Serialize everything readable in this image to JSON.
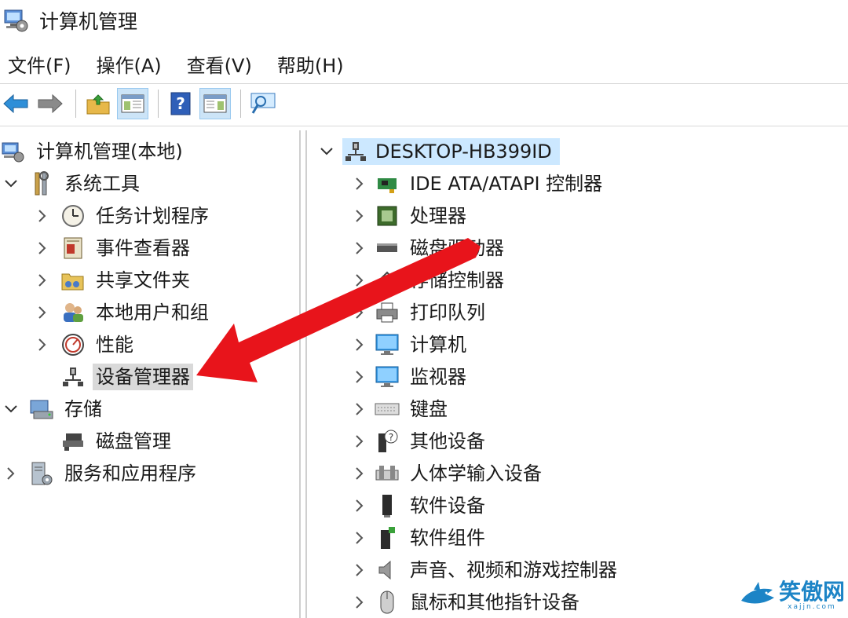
{
  "window": {
    "title": "计算机管理",
    "icon": "computer-management-icon"
  },
  "menu": [
    "文件(F)",
    "操作(A)",
    "查看(V)",
    "帮助(H)"
  ],
  "toolbar": {
    "buttons": [
      "back-arrow-icon",
      "forward-arrow-icon",
      "up-folder-icon",
      "show-hide-console-tree-icon",
      "help-icon",
      "show-hide-action-pane-icon",
      "properties-icon"
    ]
  },
  "tree": {
    "root": "计算机管理(本地)",
    "system_tools": "系统工具",
    "task_scheduler": "任务计划程序",
    "event_viewer": "事件查看器",
    "shared_folders": "共享文件夹",
    "local_users": "本地用户和组",
    "performance": "性能",
    "device_manager": "设备管理器",
    "storage": "存储",
    "disk_management": "磁盘管理",
    "services": "服务和应用程序"
  },
  "devices": {
    "computer_name": "DESKTOP-HB399ID",
    "items": [
      "IDE ATA/ATAPI 控制器",
      "处理器",
      "磁盘驱动器",
      "存储控制器",
      "打印队列",
      "计算机",
      "监视器",
      "键盘",
      "其他设备",
      "人体学输入设备",
      "软件设备",
      "软件组件",
      "声音、视频和游戏控制器",
      "鼠标和其他指针设备"
    ]
  },
  "annotation": {
    "arrow_color": "#e8141b"
  },
  "watermark": {
    "text": "笑傲网",
    "sub": "xajjn.com"
  }
}
